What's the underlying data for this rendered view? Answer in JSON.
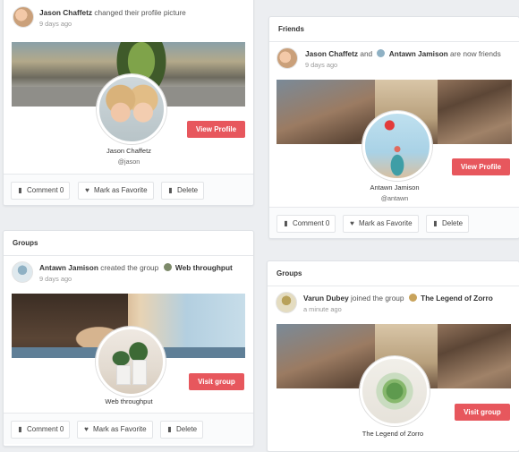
{
  "cards": [
    {
      "header": "",
      "actor": "Jason Chaffetz",
      "action": "changed their profile picture",
      "time": "9 days ago",
      "name": "Jason Chaffetz",
      "handle": "@jason",
      "cta": "View Profile",
      "footer": {
        "comment": "Comment 0",
        "favorite": "Mark as Favorite",
        "delete": "Delete"
      }
    },
    {
      "header": "Friends",
      "actor": "Jason Chaffetz",
      "connector": "and",
      "target": "Antawn Jamison",
      "action": "are now friends",
      "time": "9 days ago",
      "name": "Antawn Jamison",
      "handle": "@antawn",
      "cta": "View Profile",
      "footer": {
        "comment": "Comment 0",
        "favorite": "Mark as Favorite",
        "delete": "Delete"
      }
    },
    {
      "header": "Groups",
      "actor": "Antawn Jamison",
      "action": "created the group",
      "target": "Web throughput",
      "time": "9 days ago",
      "name": "Web throughput",
      "cta": "Visit group",
      "footer": {
        "comment": "Comment 0",
        "favorite": "Mark as Favorite",
        "delete": "Delete"
      }
    },
    {
      "header": "Groups",
      "actor": "Varun Dubey",
      "action": "joined the group",
      "target": "The Legend of Zorro",
      "time": "a minute ago",
      "name": "The Legend of Zorro",
      "cta": "Visit group"
    }
  ],
  "icons": {
    "comment": "comment-icon",
    "favorite": "heart-icon",
    "delete": "trash-icon"
  },
  "colors": {
    "accent": "#e7575d"
  }
}
